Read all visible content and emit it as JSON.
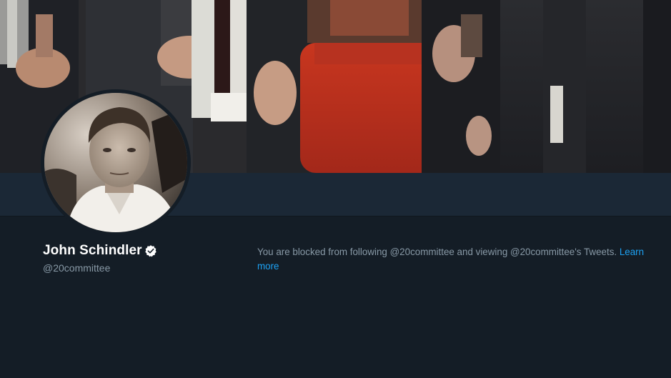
{
  "profile": {
    "display_name": "John Schindler",
    "handle": "@20committee",
    "verified": true
  },
  "blocked_notice": {
    "message": "You are blocked from following @20committee and viewing @20committee's Tweets. ",
    "learn_more_label": "Learn more"
  },
  "colors": {
    "background": "#141d26",
    "nav_strip": "#1b2836",
    "link": "#1da1f2",
    "secondary_text": "#8899a6",
    "primary_text": "#ffffff"
  },
  "icons": {
    "verified": "verified-badge-icon"
  }
}
